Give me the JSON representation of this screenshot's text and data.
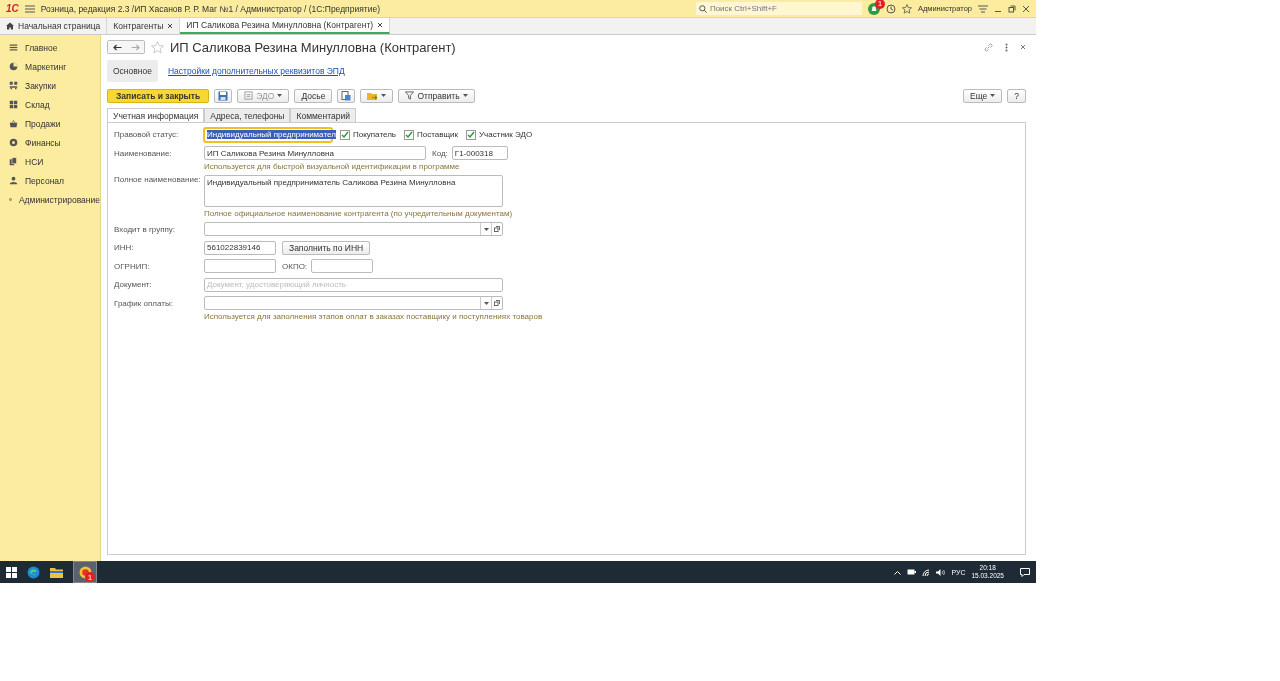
{
  "titlebar": {
    "logo": "1С",
    "app_title": "Розница, редакция 2.3 /ИП Хасанов Р. Р. Маг №1 / Администратор /  (1С:Предприятие)",
    "search": {
      "placeholder": "Поиск Ctrl+Shift+F"
    },
    "notification_count": "1",
    "user": "Администратор"
  },
  "open_tabs": [
    {
      "label": "Начальная страница",
      "kind": "home",
      "selected": false
    },
    {
      "label": "Контрагенты",
      "kind": "closable",
      "selected": false
    },
    {
      "label": "ИП Саликова Резина Минулловна (Контрагент)",
      "kind": "closable",
      "selected": true
    }
  ],
  "sidebar": {
    "items": [
      {
        "label": "Главное"
      },
      {
        "label": "Маркетинг"
      },
      {
        "label": "Закупки"
      },
      {
        "label": "Склад"
      },
      {
        "label": "Продажи"
      },
      {
        "label": "Финансы"
      },
      {
        "label": "НСИ"
      },
      {
        "label": "Персонал"
      },
      {
        "label": "Администрирование"
      }
    ]
  },
  "form": {
    "title": "ИП Саликова Резина Минулловна (Контрагент)",
    "favorite": false,
    "sections": [
      {
        "label": "Основное",
        "selected": true
      },
      {
        "label": "Настройки дополнительных реквизитов ЭПД",
        "selected": false
      }
    ],
    "toolbar": [
      {
        "kind": "primary",
        "label": "Записать и закрыть"
      },
      {
        "kind": "save"
      },
      {
        "kind": "edo",
        "label": "ЭДО",
        "disabled": true
      },
      {
        "kind": "plain",
        "label": "Досье"
      },
      {
        "kind": "report"
      },
      {
        "kind": "folder"
      },
      {
        "kind": "send",
        "label": "Отправить",
        "disabled": false
      }
    ],
    "toolbar_right": [
      {
        "kind": "menu",
        "label": "Еще"
      },
      {
        "kind": "plain",
        "label": "?"
      }
    ],
    "tabs": [
      {
        "label": "Учетная информация",
        "selected": true
      },
      {
        "label": "Адреса, телефоны",
        "selected": false
      },
      {
        "label": "Комментарий",
        "selected": false
      }
    ],
    "rows": [
      {
        "kind": "status",
        "label": "Правовой статус:",
        "value": "Индивидуальный предпринимател",
        "checkboxes": [
          {
            "label": "Покупатель",
            "checked": true
          },
          {
            "label": "Поставщик",
            "checked": true
          },
          {
            "label": "Участник ЭДО",
            "checked": true
          }
        ]
      },
      {
        "kind": "name_code",
        "label": "Наименование:",
        "value": "ИП Саликова Резина Минулловна",
        "second_label": "Код:",
        "second_value": "Г1-000318"
      },
      {
        "kind": "hint",
        "text": "Используется для быстрой визуальной идентификации в программе"
      },
      {
        "kind": "textarea",
        "label": "Полное наименование:",
        "value": "Индивидуальный предприниматель Саликова Резина Минулловна"
      },
      {
        "kind": "hint",
        "text": "Полное официальное наименование контрагента (по учредительным документам)"
      },
      {
        "kind": "combo",
        "label": "Входит в группу:"
      },
      {
        "kind": "inn",
        "label": "ИНН:",
        "value": "561022839146",
        "button": "Заполнить по ИНН"
      },
      {
        "kind": "pair",
        "label": "ОГРНИП:",
        "value": "",
        "second_label": "ОКПО:",
        "second_value": ""
      },
      {
        "kind": "text",
        "label": "Документ:",
        "placeholder": "Документ, удостоверяющий личность"
      },
      {
        "kind": "combo",
        "label": "График оплаты:"
      },
      {
        "kind": "hint",
        "text": "Используется для заполнения этапов оплат в заказах поставщику и поступлениях товаров"
      }
    ]
  },
  "taskbar": {
    "app_badge": "1",
    "language": "РУС",
    "time": "20:18",
    "date": "15.03.2025"
  }
}
